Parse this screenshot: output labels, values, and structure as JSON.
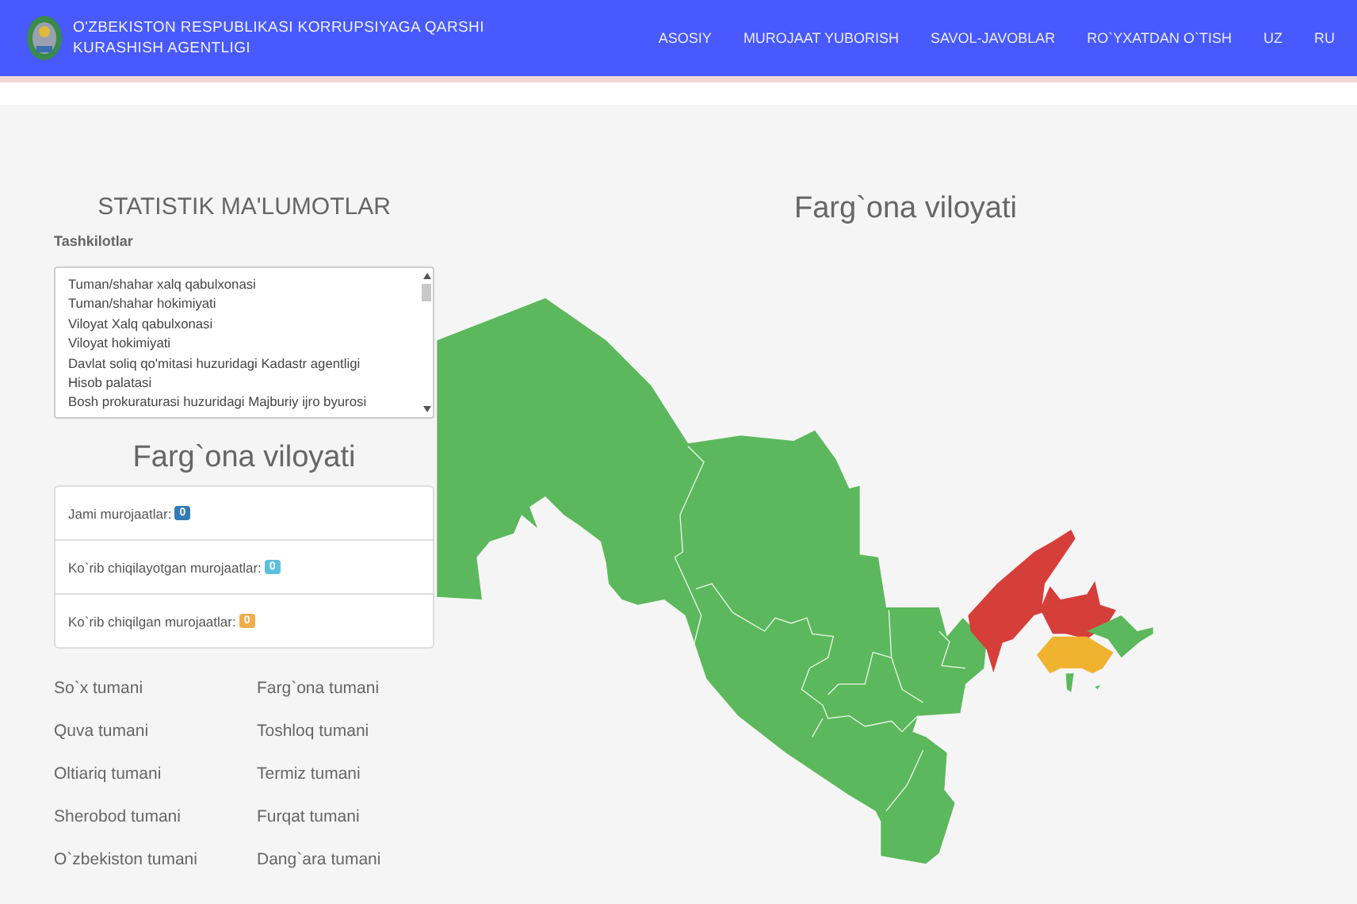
{
  "header": {
    "title_lines": [
      "O'ZBEKISTON RESPUBLIKASI KORRUPSIYAGA QARSHI",
      "KURASHISH AGENTLIGI"
    ],
    "nav": [
      "ASOSIY",
      "MUROJAAT YUBORISH",
      "SAVOL-JAVOBLAR",
      "RO`YXATDAN O`TISH",
      "UZ",
      "RU"
    ]
  },
  "statistics": {
    "title": "STATISTIK MA'LUMOTLAR",
    "label": "Tashkilotlar",
    "organizations": [
      "Tuman/shahar xalq qabulxonasi",
      "Tuman/shahar hokimiyati",
      "Viloyat Xalq qabulxonasi",
      "Viloyat hokimiyati",
      "Davlat soliq qo'mitasi huzuridagi Kadastr agentligi",
      "Hisob palatasi",
      "Bosh prokuraturasi huzuridagi Majburiy ijro byurosi"
    ]
  },
  "region": {
    "title": "Farg`ona viloyati",
    "counts": [
      {
        "label": "Jami murojaatlar:",
        "value": "0",
        "color": "#337ab7"
      },
      {
        "label": "Ko`rib chiqilayotgan murojaatlar:",
        "value": "0",
        "color": "#5bc0de"
      },
      {
        "label": "Ko`rib chiqilgan murojaatlar:",
        "value": "0",
        "color": "#f0ad4e"
      }
    ],
    "districts": [
      "So`x tumani",
      "Farg`ona tumani",
      "Quva tumani",
      "Toshloq tumani",
      "Oltiariq tumani",
      "Termiz tumani",
      "Sherobod tumani",
      "Furqat tumani",
      "O`zbekiston tumani",
      "Dang`ara tumani"
    ]
  },
  "map": {
    "title": "Farg`ona viloyati"
  }
}
